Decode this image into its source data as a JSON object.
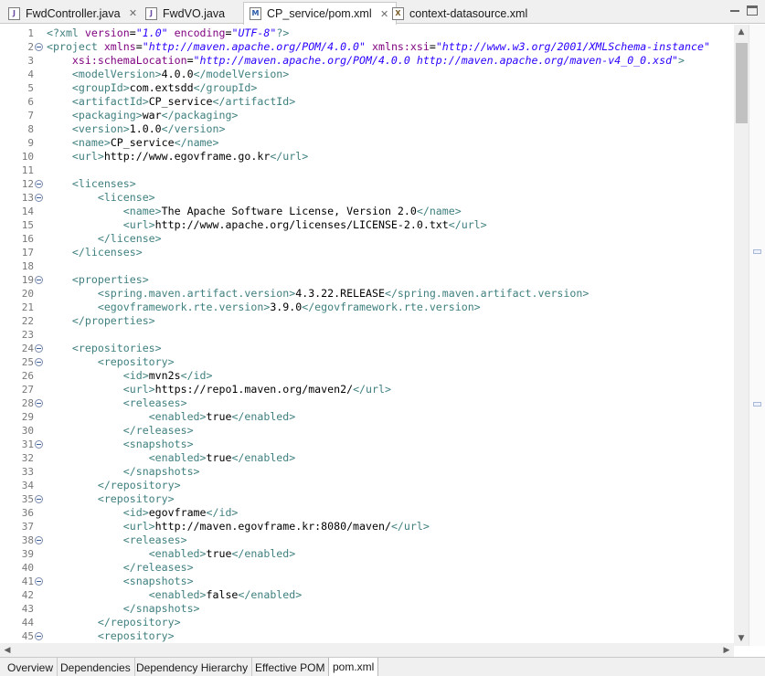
{
  "tabs": [
    {
      "label": "FwdController.java",
      "icon": "java-file-icon",
      "active": false,
      "closable": true
    },
    {
      "label": "FwdVO.java",
      "icon": "java-file-icon",
      "active": false,
      "closable": false
    },
    {
      "label": "CP_service/pom.xml",
      "icon": "maven-pom-icon",
      "active": true,
      "closable": true
    },
    {
      "label": "context-datasource.xml",
      "icon": "xml-file-icon",
      "active": false,
      "closable": false
    }
  ],
  "page_tabs": [
    "Overview",
    "Dependencies",
    "Dependency Hierarchy",
    "Effective POM",
    "pom.xml"
  ],
  "active_page_tab": "pom.xml",
  "colors": {
    "tag": "#3f7f7f",
    "attr_name": "#7f007f",
    "attr_value": "#2a00ff",
    "text": "#000000",
    "line_number": "#787878"
  },
  "lines": [
    {
      "n": "1",
      "fold": false,
      "seg": [
        [
          "tg",
          "<?"
        ],
        [
          "tg",
          "xml "
        ],
        [
          "an",
          "version"
        ],
        [
          "tx",
          "="
        ],
        [
          "av",
          "\"1.0\""
        ],
        [
          "an",
          " encoding"
        ],
        [
          "tx",
          "="
        ],
        [
          "av",
          "\"UTF-8\""
        ],
        [
          "tg",
          "?>"
        ]
      ]
    },
    {
      "n": "2",
      "fold": true,
      "seg": [
        [
          "tg",
          "<project "
        ],
        [
          "an",
          "xmlns"
        ],
        [
          "tx",
          "="
        ],
        [
          "av",
          "\"http://maven.apache.org/POM/4.0.0\""
        ],
        [
          "an",
          " xmlns:xsi"
        ],
        [
          "tx",
          "="
        ],
        [
          "av",
          "\"http://www.w3.org/2001/XMLSchema-instance\""
        ]
      ]
    },
    {
      "n": "3",
      "fold": false,
      "seg": [
        [
          "tx",
          "    "
        ],
        [
          "an",
          "xsi:schemaLocation"
        ],
        [
          "tx",
          "="
        ],
        [
          "av",
          "\"http://maven.apache.org/POM/4.0.0 http://maven.apache.org/maven-v4_0_0.xsd\""
        ],
        [
          "tg",
          ">"
        ]
      ]
    },
    {
      "n": "4",
      "fold": false,
      "seg": [
        [
          "tx",
          "    "
        ],
        [
          "tg",
          "<modelVersion>"
        ],
        [
          "tx",
          "4.0.0"
        ],
        [
          "tg",
          "</modelVersion>"
        ]
      ]
    },
    {
      "n": "5",
      "fold": false,
      "seg": [
        [
          "tx",
          "    "
        ],
        [
          "tg",
          "<groupId>"
        ],
        [
          "tx",
          "com.extsdd"
        ],
        [
          "tg",
          "</groupId>"
        ]
      ]
    },
    {
      "n": "6",
      "fold": false,
      "seg": [
        [
          "tx",
          "    "
        ],
        [
          "tg",
          "<artifactId>"
        ],
        [
          "tx",
          "CP_service"
        ],
        [
          "tg",
          "</artifactId>"
        ]
      ]
    },
    {
      "n": "7",
      "fold": false,
      "seg": [
        [
          "tx",
          "    "
        ],
        [
          "tg",
          "<packaging>"
        ],
        [
          "tx",
          "war"
        ],
        [
          "tg",
          "</packaging>"
        ]
      ]
    },
    {
      "n": "8",
      "fold": false,
      "seg": [
        [
          "tx",
          "    "
        ],
        [
          "tg",
          "<version>"
        ],
        [
          "tx",
          "1.0.0"
        ],
        [
          "tg",
          "</version>"
        ]
      ]
    },
    {
      "n": "9",
      "fold": false,
      "seg": [
        [
          "tx",
          "    "
        ],
        [
          "tg",
          "<name>"
        ],
        [
          "tx",
          "CP_service"
        ],
        [
          "tg",
          "</name>"
        ]
      ]
    },
    {
      "n": "10",
      "fold": false,
      "seg": [
        [
          "tx",
          "    "
        ],
        [
          "tg",
          "<url>"
        ],
        [
          "tx",
          "http://www.egovframe.go.kr"
        ],
        [
          "tg",
          "</url>"
        ]
      ]
    },
    {
      "n": "11",
      "fold": false,
      "seg": []
    },
    {
      "n": "12",
      "fold": true,
      "seg": [
        [
          "tx",
          "    "
        ],
        [
          "tg",
          "<licenses>"
        ]
      ]
    },
    {
      "n": "13",
      "fold": true,
      "seg": [
        [
          "tx",
          "        "
        ],
        [
          "tg",
          "<license>"
        ]
      ]
    },
    {
      "n": "14",
      "fold": false,
      "seg": [
        [
          "tx",
          "            "
        ],
        [
          "tg",
          "<name>"
        ],
        [
          "tx",
          "The Apache Software License, Version 2.0"
        ],
        [
          "tg",
          "</name>"
        ]
      ]
    },
    {
      "n": "15",
      "fold": false,
      "seg": [
        [
          "tx",
          "            "
        ],
        [
          "tg",
          "<url>"
        ],
        [
          "tx",
          "http://www.apache.org/licenses/LICENSE-2.0.txt"
        ],
        [
          "tg",
          "</url>"
        ]
      ]
    },
    {
      "n": "16",
      "fold": false,
      "seg": [
        [
          "tx",
          "        "
        ],
        [
          "tg",
          "</license>"
        ]
      ]
    },
    {
      "n": "17",
      "fold": false,
      "seg": [
        [
          "tx",
          "    "
        ],
        [
          "tg",
          "</licenses>"
        ]
      ]
    },
    {
      "n": "18",
      "fold": false,
      "seg": []
    },
    {
      "n": "19",
      "fold": true,
      "seg": [
        [
          "tx",
          "    "
        ],
        [
          "tg",
          "<properties>"
        ]
      ]
    },
    {
      "n": "20",
      "fold": false,
      "seg": [
        [
          "tx",
          "        "
        ],
        [
          "tg",
          "<spring.maven.artifact.version>"
        ],
        [
          "tx",
          "4.3.22.RELEASE"
        ],
        [
          "tg",
          "</spring.maven.artifact.version>"
        ]
      ]
    },
    {
      "n": "21",
      "fold": false,
      "seg": [
        [
          "tx",
          "        "
        ],
        [
          "tg",
          "<egovframework.rte.version>"
        ],
        [
          "tx",
          "3.9.0"
        ],
        [
          "tg",
          "</egovframework.rte.version>"
        ]
      ]
    },
    {
      "n": "22",
      "fold": false,
      "seg": [
        [
          "tx",
          "    "
        ],
        [
          "tg",
          "</properties>"
        ]
      ]
    },
    {
      "n": "23",
      "fold": false,
      "seg": []
    },
    {
      "n": "24",
      "fold": true,
      "seg": [
        [
          "tx",
          "    "
        ],
        [
          "tg",
          "<repositories>"
        ]
      ]
    },
    {
      "n": "25",
      "fold": true,
      "seg": [
        [
          "tx",
          "        "
        ],
        [
          "tg",
          "<repository>"
        ]
      ]
    },
    {
      "n": "26",
      "fold": false,
      "seg": [
        [
          "tx",
          "            "
        ],
        [
          "tg",
          "<id>"
        ],
        [
          "tx",
          "mvn2s"
        ],
        [
          "tg",
          "</id>"
        ]
      ]
    },
    {
      "n": "27",
      "fold": false,
      "seg": [
        [
          "tx",
          "            "
        ],
        [
          "tg",
          "<url>"
        ],
        [
          "tx",
          "https://repo1.maven.org/maven2/"
        ],
        [
          "tg",
          "</url>"
        ]
      ]
    },
    {
      "n": "28",
      "fold": true,
      "seg": [
        [
          "tx",
          "            "
        ],
        [
          "tg",
          "<releases>"
        ]
      ]
    },
    {
      "n": "29",
      "fold": false,
      "seg": [
        [
          "tx",
          "                "
        ],
        [
          "tg",
          "<enabled>"
        ],
        [
          "tx",
          "true"
        ],
        [
          "tg",
          "</enabled>"
        ]
      ]
    },
    {
      "n": "30",
      "fold": false,
      "seg": [
        [
          "tx",
          "            "
        ],
        [
          "tg",
          "</releases>"
        ]
      ]
    },
    {
      "n": "31",
      "fold": true,
      "seg": [
        [
          "tx",
          "            "
        ],
        [
          "tg",
          "<snapshots>"
        ]
      ]
    },
    {
      "n": "32",
      "fold": false,
      "seg": [
        [
          "tx",
          "                "
        ],
        [
          "tg",
          "<enabled>"
        ],
        [
          "tx",
          "true"
        ],
        [
          "tg",
          "</enabled>"
        ]
      ]
    },
    {
      "n": "33",
      "fold": false,
      "seg": [
        [
          "tx",
          "            "
        ],
        [
          "tg",
          "</snapshots>"
        ]
      ]
    },
    {
      "n": "34",
      "fold": false,
      "seg": [
        [
          "tx",
          "        "
        ],
        [
          "tg",
          "</repository>"
        ]
      ]
    },
    {
      "n": "35",
      "fold": true,
      "seg": [
        [
          "tx",
          "        "
        ],
        [
          "tg",
          "<repository>"
        ]
      ]
    },
    {
      "n": "36",
      "fold": false,
      "seg": [
        [
          "tx",
          "            "
        ],
        [
          "tg",
          "<id>"
        ],
        [
          "tx",
          "egovframe"
        ],
        [
          "tg",
          "</id>"
        ]
      ]
    },
    {
      "n": "37",
      "fold": false,
      "seg": [
        [
          "tx",
          "            "
        ],
        [
          "tg",
          "<url>"
        ],
        [
          "tx",
          "http://maven.egovframe.kr:8080/maven/"
        ],
        [
          "tg",
          "</url>"
        ]
      ]
    },
    {
      "n": "38",
      "fold": true,
      "seg": [
        [
          "tx",
          "            "
        ],
        [
          "tg",
          "<releases>"
        ]
      ]
    },
    {
      "n": "39",
      "fold": false,
      "seg": [
        [
          "tx",
          "                "
        ],
        [
          "tg",
          "<enabled>"
        ],
        [
          "tx",
          "true"
        ],
        [
          "tg",
          "</enabled>"
        ]
      ]
    },
    {
      "n": "40",
      "fold": false,
      "seg": [
        [
          "tx",
          "            "
        ],
        [
          "tg",
          "</releases>"
        ]
      ]
    },
    {
      "n": "41",
      "fold": true,
      "seg": [
        [
          "tx",
          "            "
        ],
        [
          "tg",
          "<snapshots>"
        ]
      ]
    },
    {
      "n": "42",
      "fold": false,
      "seg": [
        [
          "tx",
          "                "
        ],
        [
          "tg",
          "<enabled>"
        ],
        [
          "tx",
          "false"
        ],
        [
          "tg",
          "</enabled>"
        ]
      ]
    },
    {
      "n": "43",
      "fold": false,
      "seg": [
        [
          "tx",
          "            "
        ],
        [
          "tg",
          "</snapshots>"
        ]
      ]
    },
    {
      "n": "44",
      "fold": false,
      "seg": [
        [
          "tx",
          "        "
        ],
        [
          "tg",
          "</repository>"
        ]
      ]
    },
    {
      "n": "45",
      "fold": true,
      "seg": [
        [
          "tx",
          "        "
        ],
        [
          "tg",
          "<repository>"
        ]
      ]
    }
  ]
}
